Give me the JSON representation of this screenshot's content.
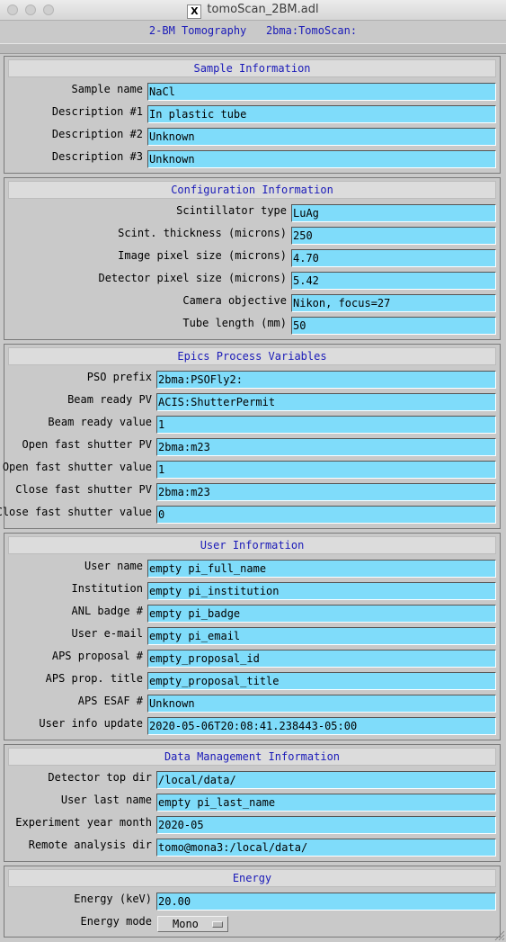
{
  "window": {
    "title": "tomoScan_2BM.adl",
    "x_logo": "X"
  },
  "header": {
    "text": "2-BM Tomography   2bma:TomoScan:"
  },
  "sections": {
    "sample": {
      "title": "Sample Information",
      "rows": [
        {
          "label": "Sample name",
          "value": "NaCl"
        },
        {
          "label": "Description #1",
          "value": "In plastic tube"
        },
        {
          "label": "Description #2",
          "value": "Unknown"
        },
        {
          "label": "Description #3",
          "value": "Unknown"
        }
      ]
    },
    "config": {
      "title": "Configuration Information",
      "rows": [
        {
          "label": "Scintillator type",
          "value": "LuAg"
        },
        {
          "label": "Scint. thickness (microns)",
          "value": "250"
        },
        {
          "label": "Image pixel size (microns)",
          "value": "4.70"
        },
        {
          "label": "Detector pixel size (microns)",
          "value": "5.42"
        },
        {
          "label": "Camera objective",
          "value": "Nikon, focus=27"
        },
        {
          "label": "Tube length (mm)",
          "value": "50"
        }
      ]
    },
    "epics": {
      "title": "Epics Process Variables",
      "rows": [
        {
          "label": "PSO prefix",
          "value": "2bma:PSOFly2:"
        },
        {
          "label": "Beam ready PV",
          "value": "ACIS:ShutterPermit"
        },
        {
          "label": "Beam ready value",
          "value": "1"
        },
        {
          "label": "Open fast shutter PV",
          "value": "2bma:m23"
        },
        {
          "label": "Open fast shutter value",
          "value": "1"
        },
        {
          "label": "Close fast shutter PV",
          "value": "2bma:m23"
        },
        {
          "label": "Close fast shutter value",
          "value": "0"
        }
      ]
    },
    "user": {
      "title": "User Information",
      "rows": [
        {
          "label": "User name",
          "value": "empty pi_full_name"
        },
        {
          "label": "Institution",
          "value": "empty pi_institution"
        },
        {
          "label": "ANL badge #",
          "value": "empty pi_badge"
        },
        {
          "label": "User e-mail",
          "value": "empty pi_email"
        },
        {
          "label": "APS proposal #",
          "value": "empty_proposal_id"
        },
        {
          "label": "APS prop. title",
          "value": "empty_proposal_title"
        },
        {
          "label": "APS ESAF #",
          "value": "Unknown"
        },
        {
          "label": "User info update",
          "value": "2020-05-06T20:08:41.238443-05:00"
        }
      ]
    },
    "datamgmt": {
      "title": "Data Management Information",
      "rows": [
        {
          "label": "Detector top dir",
          "value": "/local/data/"
        },
        {
          "label": "User last name",
          "value": "empty pi_last_name"
        },
        {
          "label": "Experiment year month",
          "value": "2020-05"
        },
        {
          "label": "Remote analysis dir",
          "value": "tomo@mona3:/local/data/"
        }
      ]
    },
    "energy": {
      "title": "Energy",
      "rows": [
        {
          "label": "Energy (keV)",
          "value": "20.00"
        }
      ],
      "mode_label": "Energy mode",
      "mode_value": "Mono"
    }
  },
  "colors": {
    "field_bg": "#7fdcfa",
    "title_text": "#1a1ab8",
    "panel_bg": "#c9c9c9"
  }
}
